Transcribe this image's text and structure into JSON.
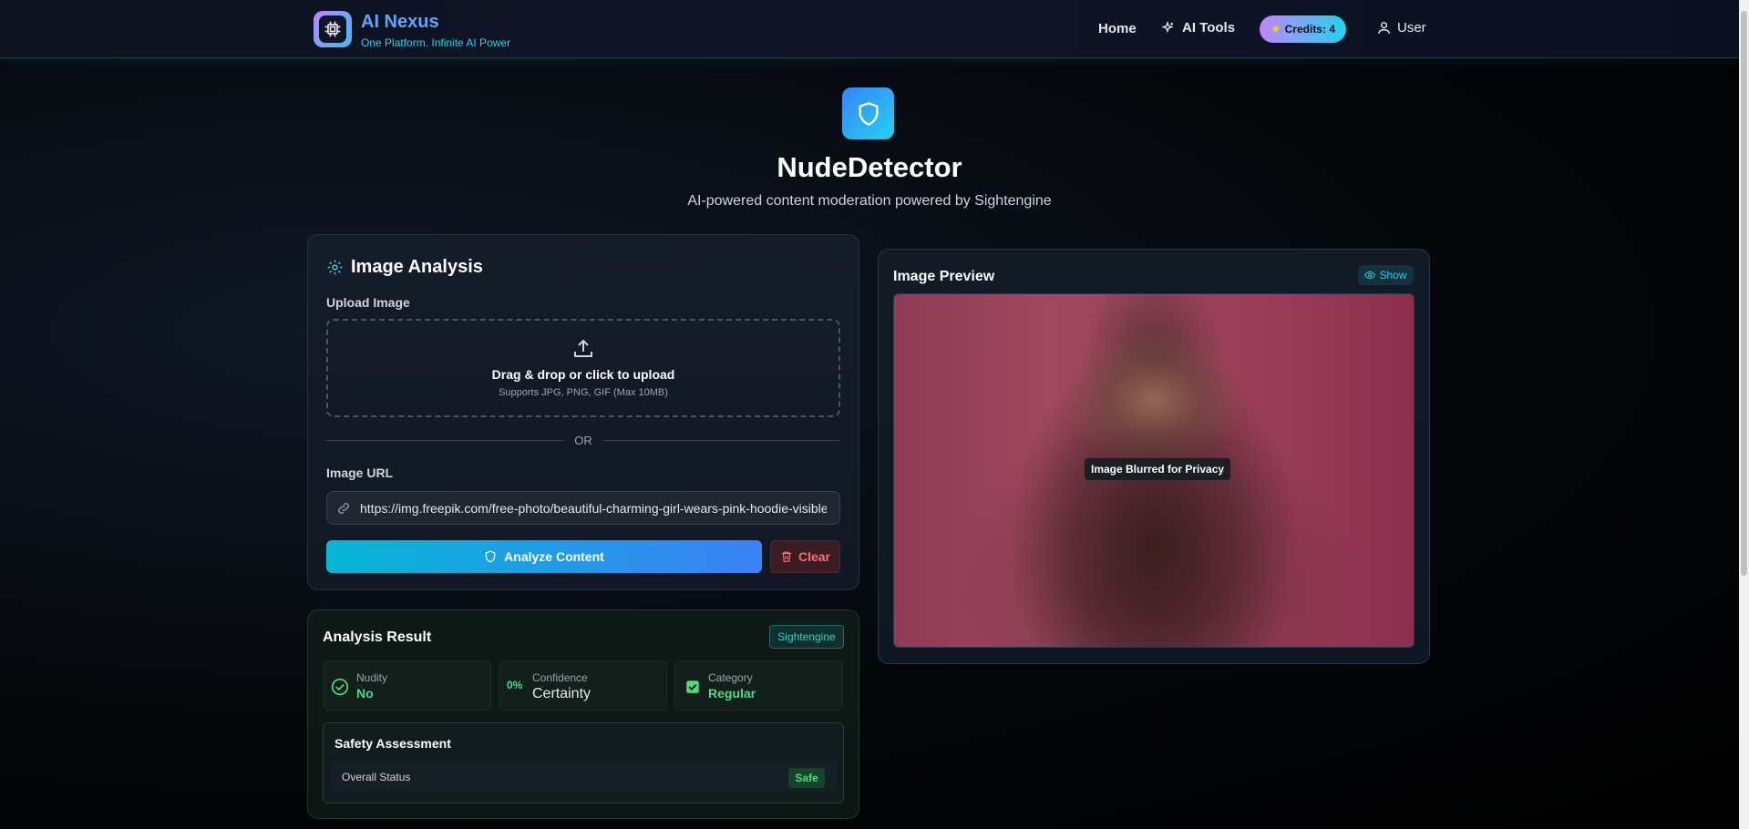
{
  "brand": {
    "title": "AI Nexus",
    "subtitle": "One Platform. Infinite AI Power",
    "logo_icon": "chip-icon"
  },
  "nav": {
    "home": "Home",
    "ai_tools": "AI Tools",
    "credits": "Credits: 4",
    "user": "User"
  },
  "hero": {
    "icon": "shield-icon",
    "title": "NudeDetector",
    "subtitle": "AI-powered content moderation powered by Sightengine"
  },
  "analysis": {
    "title": "Image Analysis",
    "upload_label": "Upload Image",
    "dropzone_title": "Drag & drop or click to upload",
    "dropzone_sub": "Supports JPG, PNG, GIF (Max 10MB)",
    "or_text": "OR",
    "url_label": "Image URL",
    "url_value": "https://img.freepik.com/free-photo/beautiful-charming-girl-wears-pink-hoodie-visible",
    "analyze_button": "Analyze Content",
    "clear_button": "Clear"
  },
  "preview": {
    "title": "Image Preview",
    "show_button": "Show",
    "blur_badge": "Image Blurred for Privacy"
  },
  "result": {
    "title": "Analysis Result",
    "provider_tag": "Sightengine",
    "stats": [
      {
        "label": "Nudity",
        "value": "No",
        "icon": "check-circle-icon"
      },
      {
        "label": "Confidence",
        "value": "Certainty",
        "badge": "0%"
      },
      {
        "label": "Category",
        "value": "Regular",
        "icon": "checkbox-icon"
      }
    ],
    "safety": {
      "title": "Safety Assessment",
      "status_label": "Overall Status",
      "status_value": "Safe"
    }
  },
  "colors": {
    "accent_cyan": "#22d3ee",
    "accent_blue": "#3b82f6",
    "success_green": "#4ade80",
    "danger_red": "#f87171"
  }
}
